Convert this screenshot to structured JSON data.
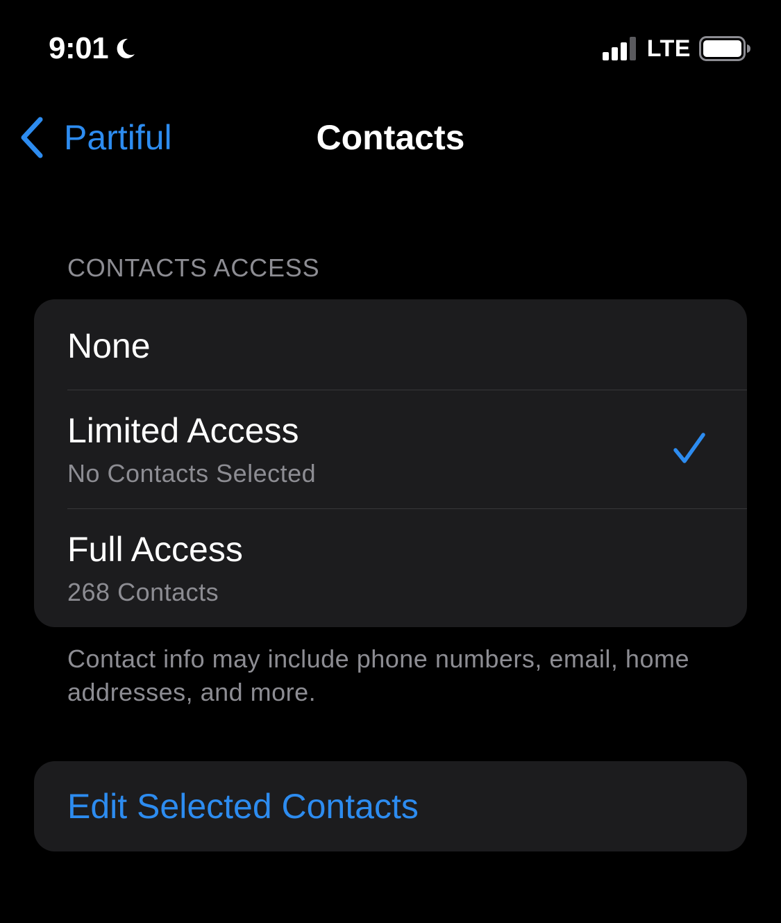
{
  "status_bar": {
    "time": "9:01",
    "focus_icon": "moon-icon",
    "signal_icon": "signal-icon",
    "network": "LTE",
    "battery_icon": "battery-icon"
  },
  "nav": {
    "back_label": "Partiful",
    "back_icon": "chevron-left-icon",
    "title": "Contacts"
  },
  "section": {
    "header": "CONTACTS ACCESS",
    "options": [
      {
        "title": "None",
        "subtitle": "",
        "selected": false
      },
      {
        "title": "Limited Access",
        "subtitle": "No Contacts Selected",
        "selected": true
      },
      {
        "title": "Full Access",
        "subtitle": "268 Contacts",
        "selected": false
      }
    ],
    "footer": "Contact info may include phone numbers, email, home addresses, and more."
  },
  "edit_button": {
    "label": "Edit Selected Contacts"
  },
  "colors": {
    "accent": "#2d8cf0",
    "background": "#000000",
    "card": "#1c1c1e",
    "secondary_text": "#8d8d93",
    "divider": "#38383a"
  }
}
